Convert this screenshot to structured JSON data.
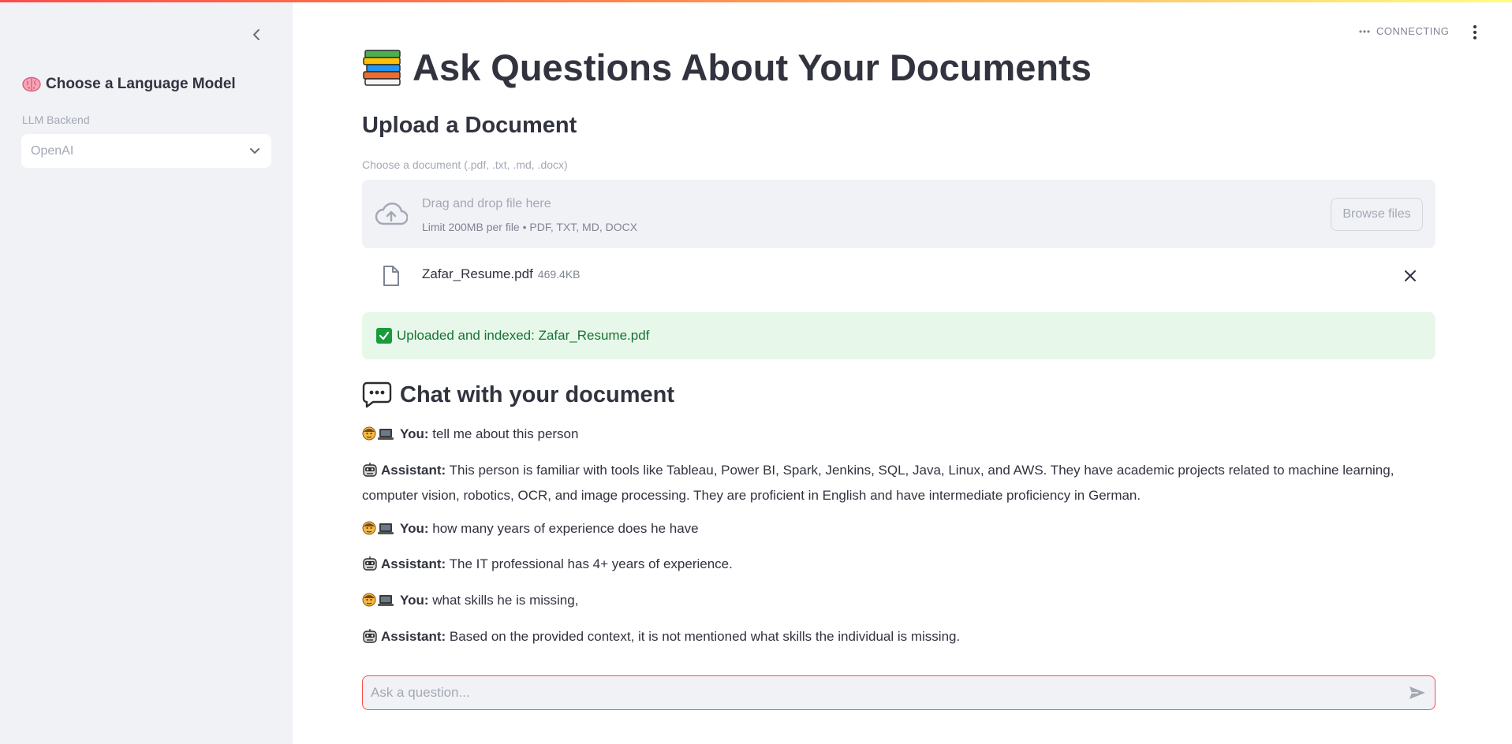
{
  "sidebar": {
    "heading": "Choose a Language Model",
    "heading_icon": "brain-icon",
    "select_label": "LLM Backend",
    "select_value": "OpenAI"
  },
  "status": {
    "text": "CONNECTING"
  },
  "main": {
    "title": "Ask Questions About Your Documents",
    "title_icon": "books-icon",
    "upload_heading": "Upload a Document",
    "uploader": {
      "label": "Choose a document (.pdf, .txt, .md, .docx)",
      "drop_text": "Drag and drop file here",
      "limit_text": "Limit 200MB per file • PDF, TXT, MD, DOCX",
      "browse_label": "Browse files"
    },
    "uploaded_file": {
      "name": "Zafar_Resume.pdf",
      "size": "469.4KB"
    },
    "success_message": "Uploaded and indexed: Zafar_Resume.pdf",
    "chat_heading": "Chat with your document",
    "chat_heading_icon": "speech-bubble-icon"
  },
  "chat": {
    "messages": [
      {
        "role": "You:",
        "text": "tell me about this person"
      },
      {
        "role": "Assistant:",
        "text": "This person is familiar with tools like Tableau, Power BI, Spark, Jenkins, SQL, Java, Linux, and AWS. They have academic projects related to machine learning, computer vision, robotics, OCR, and image processing. They are proficient in English and have intermediate proficiency in German."
      },
      {
        "role": "You:",
        "text": "how many years of experience does he have"
      },
      {
        "role": "Assistant:",
        "text": "The IT professional has 4+ years of experience."
      },
      {
        "role": "You:",
        "text": "what skills he is missing,"
      },
      {
        "role": "Assistant:",
        "text": "Based on the provided context, it is not mentioned what skills the individual is missing."
      }
    ],
    "input_placeholder": "Ask a question...",
    "input_value": ""
  },
  "colors": {
    "accent": "#ff4b4b",
    "sidebar_bg": "#f0f2f6",
    "success_bg": "#e7f8ea",
    "success_text": "#177233"
  }
}
